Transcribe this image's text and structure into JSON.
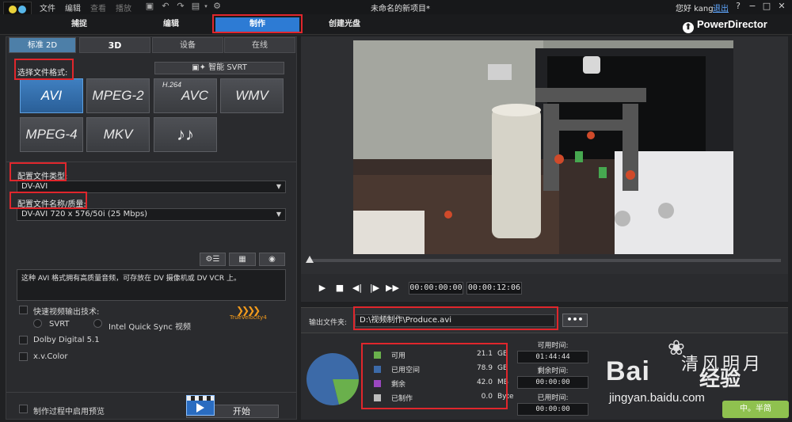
{
  "menu": {
    "items": [
      "文件",
      "编辑",
      "查看",
      "播放"
    ],
    "dim": [
      false,
      false,
      true,
      true
    ]
  },
  "window": {
    "title": "未命名的新项目*",
    "greeting": "您好 kang",
    "logout": "退出",
    "help": "?",
    "minimize": "−",
    "restore": "□",
    "close": "✕"
  },
  "modes": {
    "capture": "捕捉",
    "edit": "编辑",
    "produce": "制作",
    "disc": "创建光盘",
    "brand": "PowerDirector"
  },
  "tabs": [
    "标准 2D",
    "3D",
    "设备",
    "在线"
  ],
  "format": {
    "label": "选择文件格式:",
    "svrt_button": "智能 SVRT",
    "options": [
      {
        "label": "AVI",
        "prefix": "",
        "selected": true
      },
      {
        "label": "MPEG-2",
        "prefix": "",
        "selected": false
      },
      {
        "label": "AVC",
        "prefix": "H.264",
        "selected": false
      },
      {
        "label": "WMV",
        "prefix": "",
        "selected": false
      },
      {
        "label": "MPEG-4",
        "prefix": "",
        "selected": false
      },
      {
        "label": "MKV",
        "prefix": "",
        "selected": false
      },
      {
        "label": "♪♪",
        "prefix": "",
        "selected": false
      }
    ]
  },
  "profile": {
    "type_label": "配置文件类型:",
    "type_value": "DV-AVI",
    "name_label": "配置文件名称/质量:",
    "name_value": "DV-AVI 720 x 576/50i (25 Mbps)"
  },
  "description": "这种 AVI 格式拥有高质量音频，可存放在 DV 摄像机或 DV VCR 上。",
  "options": {
    "fast_render": "快速视频输出技术:",
    "svrt": "SVRT",
    "intel": "Intel Quick Sync 视频",
    "dolby": "Dolby Digital 5.1",
    "xvcolor": "x.v.Color",
    "preview_during": "制作过程中启用预览",
    "truevelocity": "TrueVelocity4"
  },
  "start_label": "开始",
  "player": {
    "current_time": "00:00:00:00",
    "total_time": "00:00:12:06",
    "progress": 0
  },
  "output": {
    "label": "输出文件夹:",
    "path": "D:\\视频制作\\Produce.avi",
    "browse": "•••"
  },
  "disk": {
    "legend": [
      {
        "name": "可用",
        "value": "21.1",
        "unit": "GB",
        "color": "#6ab04c"
      },
      {
        "name": "已用空间",
        "value": "78.9",
        "unit": "GB",
        "color": "#3c6aa8"
      },
      {
        "name": "剩余",
        "value": "42.0",
        "unit": "MB",
        "color": "#9b47c0"
      },
      {
        "name": "已制作",
        "value": "0.0",
        "unit": "Byte",
        "color": "#bdbdbd"
      }
    ],
    "pie_fractions": {
      "available": 0.211,
      "used": 0.789
    },
    "available_time_label": "可用时间:",
    "available_time": "01:44:44",
    "remaining_time_label": "剩余时间:",
    "remaining_time": "00:00:00",
    "elapsed_time_label": "已用时间:",
    "elapsed_time": "00:00:00"
  },
  "watermark": {
    "baidu": "Bai",
    "jingyan": "经验",
    "url": "jingyan.baidu.com",
    "brand": "清风明月",
    "seal": "中。半简"
  }
}
